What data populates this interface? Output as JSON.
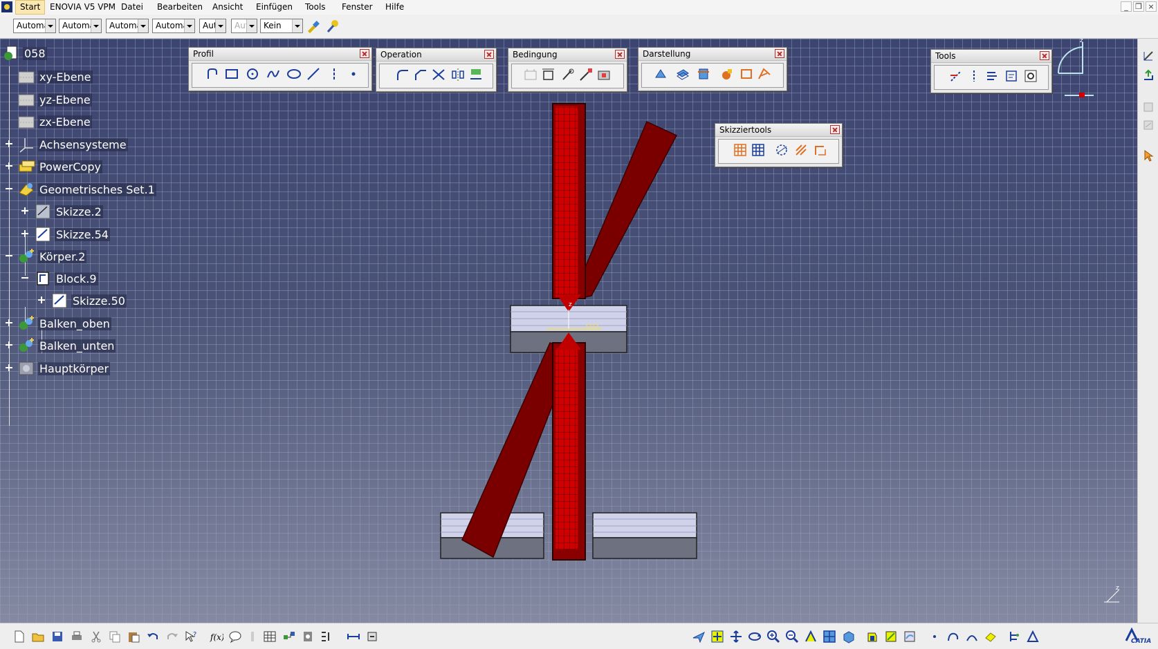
{
  "menubar": {
    "items": [
      "Start",
      "ENOVIA V5 VPM",
      "Datei",
      "Bearbeiten",
      "Ansicht",
      "Einfügen",
      "Tools",
      "Fenster",
      "Hilfe"
    ],
    "active": "Start"
  },
  "window_controls": {
    "minimize": "_",
    "restore": "❐",
    "close": "×"
  },
  "toolbar_top": {
    "combos": [
      "Automa",
      "Automa",
      "Automa",
      "Automa",
      "Aut",
      "Aut",
      "Kein"
    ]
  },
  "tree": {
    "root": "058",
    "nodes": [
      {
        "label": "xy-Ebene"
      },
      {
        "label": "yz-Ebene"
      },
      {
        "label": "zx-Ebene"
      },
      {
        "label": "Achsensysteme"
      },
      {
        "label": "PowerCopy"
      },
      {
        "label": "Geometrisches Set.1"
      },
      {
        "label": "Skizze.2"
      },
      {
        "label": "Skizze.54"
      },
      {
        "label": "Körper.2"
      },
      {
        "label": "Block.9"
      },
      {
        "label": "Skizze.50"
      },
      {
        "label": "Balken_oben"
      },
      {
        "label": "Balken_unten"
      },
      {
        "label": "Hauptkörper"
      }
    ]
  },
  "panels": {
    "profil": {
      "title": "Profil"
    },
    "operation": {
      "title": "Operation"
    },
    "bedingung": {
      "title": "Bedingung"
    },
    "darstellung": {
      "title": "Darstellung"
    },
    "tools": {
      "title": "Tools"
    },
    "skizziertools": {
      "title": "Skizziertools"
    }
  },
  "viewport": {
    "origin_label": "z",
    "compass_label": "z",
    "axis_label": "z"
  },
  "brand": {
    "name": "CATIA"
  },
  "colors": {
    "viewport_bg": "#4a5377",
    "beam_red": "#7a0000",
    "beam_bright": "#d40000",
    "grid": "#9aa0bf",
    "menu_active": "#fbe7b0"
  }
}
